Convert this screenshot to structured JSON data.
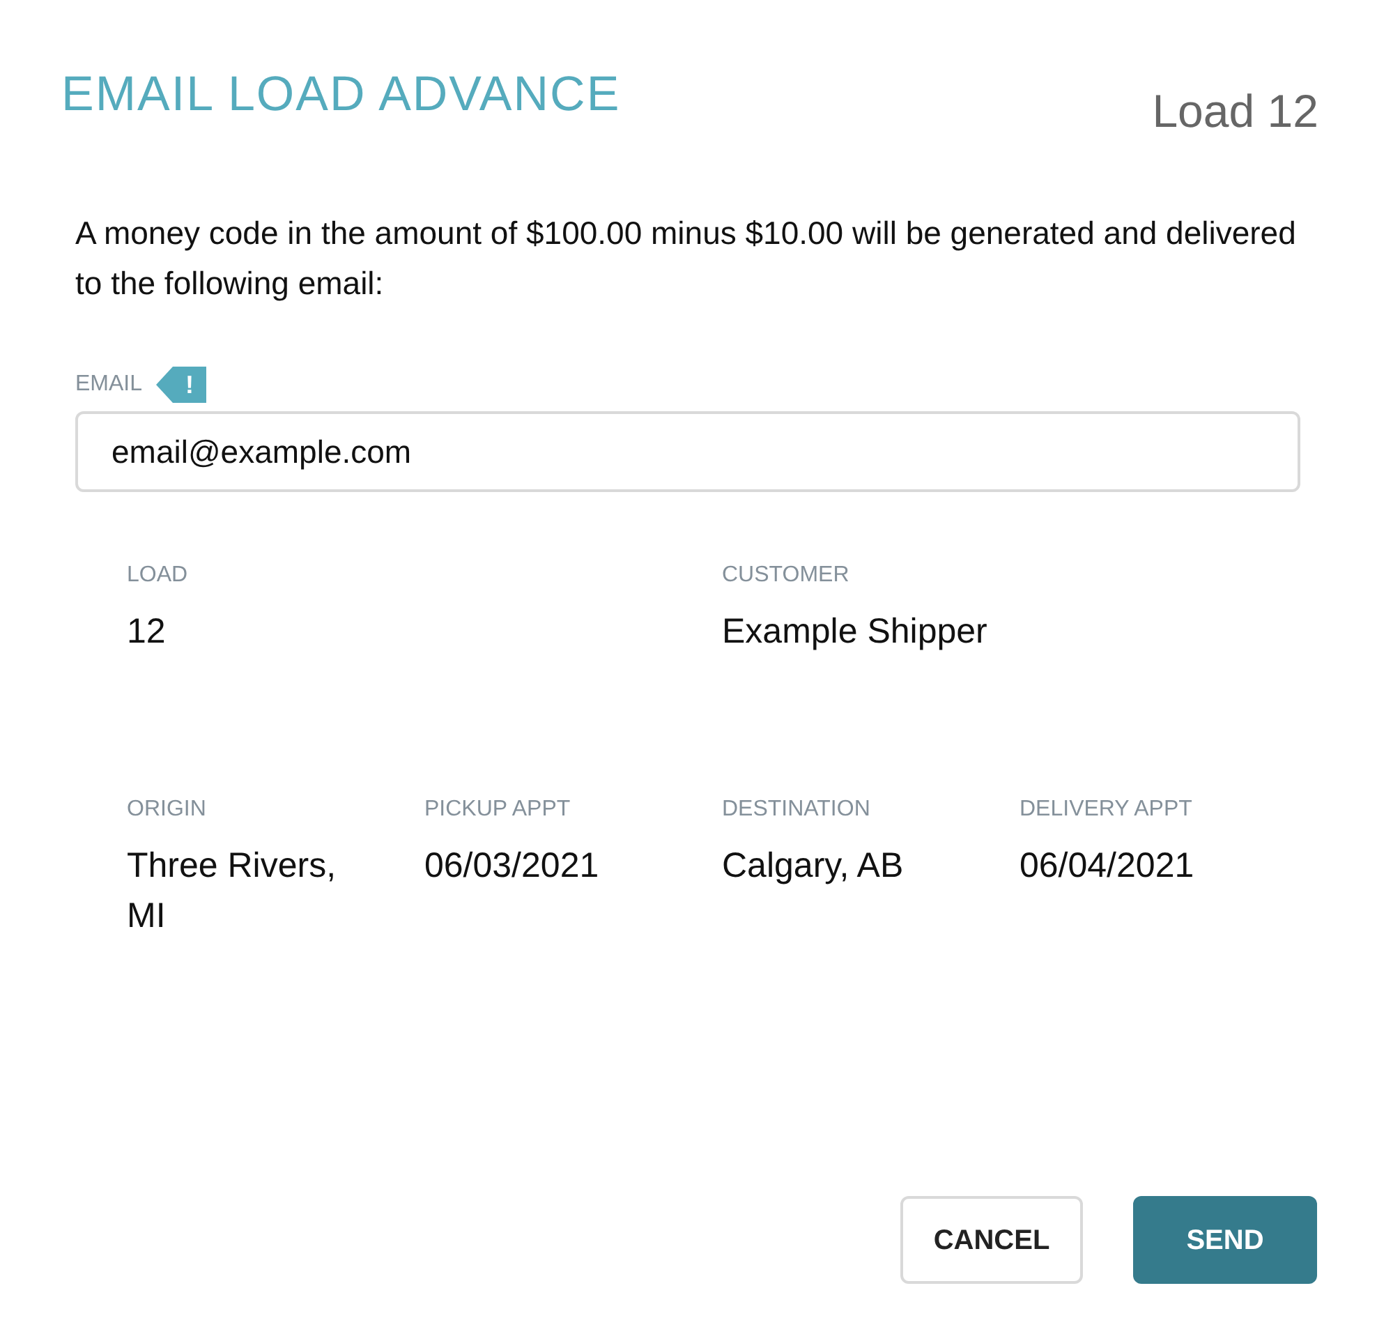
{
  "dialog": {
    "title": "EMAIL LOAD ADVANCE",
    "subtitle": "Load 12"
  },
  "message": "A money code in the amount of $100.00 minus $10.00 will be generated and delivered to the following email:",
  "email": {
    "label": "EMAIL",
    "badge": "!",
    "value": "email@example.com"
  },
  "details": [
    [
      {
        "label": "LOAD",
        "value": "12"
      },
      {
        "label": "CUSTOMER",
        "value": "Example Shipper"
      }
    ],
    [
      {
        "label": "ORIGIN",
        "value": "Three Rivers, MI"
      },
      {
        "label": "PICKUP APPT",
        "value": "06/03/2021"
      },
      {
        "label": "DESTINATION",
        "value": "Calgary, AB"
      },
      {
        "label": "DELIVERY APPT",
        "value": "06/04/2021"
      }
    ]
  ],
  "buttons": [
    {
      "label": "CANCEL",
      "kind": "secondary"
    },
    {
      "label": "SEND",
      "kind": "primary"
    }
  ]
}
